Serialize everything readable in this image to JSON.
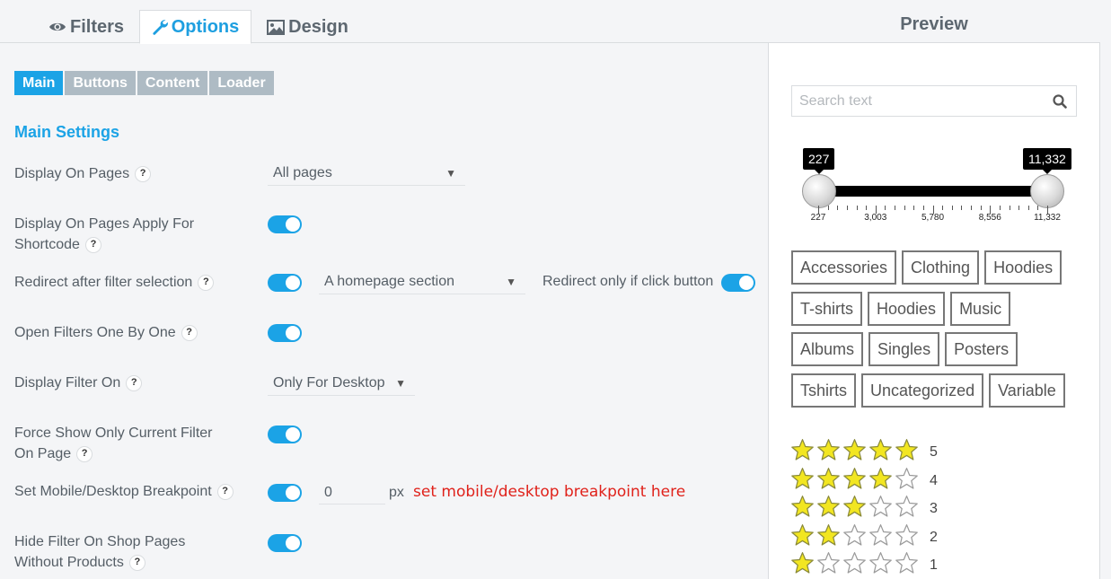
{
  "tabs": [
    {
      "label": "Filters",
      "icon": "eye-icon"
    },
    {
      "label": "Options",
      "icon": "wrench-icon",
      "active": true
    },
    {
      "label": "Design",
      "icon": "image-icon"
    }
  ],
  "subtabs": [
    {
      "label": "Main",
      "active": true
    },
    {
      "label": "Buttons"
    },
    {
      "label": "Content"
    },
    {
      "label": "Loader"
    }
  ],
  "section_title": "Main Settings",
  "help_symbol": "?",
  "settings": {
    "display_on_pages": {
      "label": "Display On Pages",
      "value": "All pages"
    },
    "apply_for_shortcode": {
      "label_line1": "Display On Pages Apply For",
      "label_line2": "Shortcode",
      "enabled": true
    },
    "redirect": {
      "label": "Redirect after filter selection",
      "enabled": true,
      "value": "A homepage section",
      "only_click_label": "Redirect only if click button",
      "only_click_enabled": true
    },
    "open_one_by_one": {
      "label": "Open Filters One By One",
      "enabled": true
    },
    "display_filter_on": {
      "label": "Display Filter On",
      "value": "Only For Desktop"
    },
    "force_show": {
      "label_line1": "Force Show Only Current Filter",
      "label_line2": "On Page",
      "enabled": true
    },
    "breakpoint": {
      "label": "Set Mobile/Desktop Breakpoint",
      "enabled": true,
      "value": "0",
      "unit": "px",
      "note": "set mobile/desktop breakpoint here"
    },
    "hide_filter": {
      "label_line1": "Hide Filter On Shop Pages",
      "label_line2": "Without Products",
      "enabled": true
    }
  },
  "preview": {
    "title": "Preview",
    "search_placeholder": "Search text",
    "slider": {
      "min_label": "227",
      "max_label": "11,332",
      "min": 227,
      "max": 11332,
      "selected_min": 227,
      "selected_max": 11332,
      "tick_labels": [
        "227",
        "3,003",
        "5,780",
        "8,556",
        "11,332"
      ]
    },
    "categories": [
      [
        "Accessories",
        "Clothing",
        "Hoodies"
      ],
      [
        "T-shirts",
        "Hoodies",
        "Music"
      ],
      [
        "Albums",
        "Singles",
        "Posters"
      ],
      [
        "Tshirts",
        "Uncategorized",
        "Variable"
      ]
    ],
    "ratings": [
      {
        "label": "5",
        "filled": 5
      },
      {
        "label": "4",
        "filled": 4
      },
      {
        "label": "3",
        "filled": 3
      },
      {
        "label": "2",
        "filled": 2
      },
      {
        "label": "1",
        "filled": 1
      }
    ],
    "star_count": 5,
    "colors": {
      "accent": "#1ba3e6",
      "star_fill": "#f2e621",
      "note": "#e0221b"
    }
  }
}
